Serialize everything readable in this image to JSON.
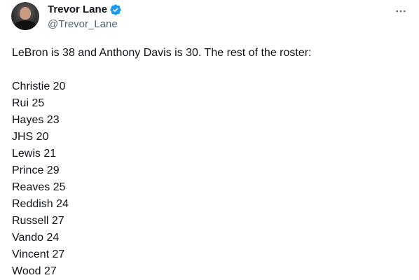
{
  "author": {
    "name": "Trevor Lane",
    "handle": "@Trevor_Lane",
    "verified_color": "#1d9bf0"
  },
  "more_icon": "more-horizontal-icon",
  "tweet": {
    "intro": "LeBron is 38 and Anthony Davis is 30. The rest of the roster:",
    "roster": [
      "Christie 20",
      "Rui 25",
      "Hayes 23",
      "JHS 20",
      "Lewis 21",
      "Prince 29",
      "Reaves 25",
      "Reddish 24",
      "Russell 27",
      "Vando 24",
      "Vincent 27",
      "Wood 27"
    ]
  }
}
